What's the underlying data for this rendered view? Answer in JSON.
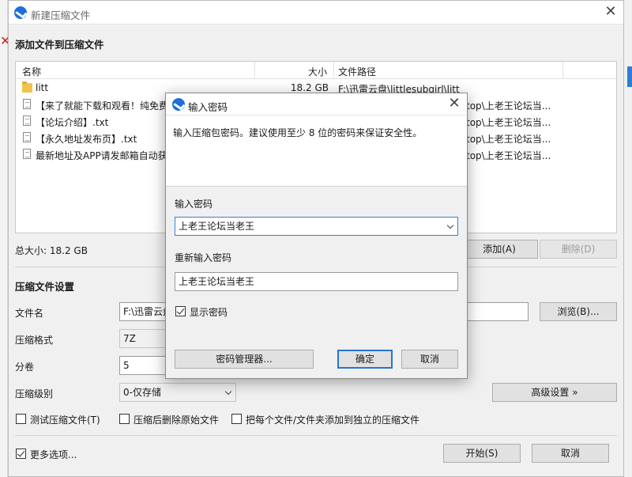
{
  "main_window": {
    "title": "新建压缩文件",
    "add_section_title": "添加文件到压缩文件",
    "columns": {
      "name": "名称",
      "size": "大小",
      "path": "文件路径"
    },
    "files": [
      {
        "icon": "folder-icon",
        "name": "litt",
        "size": "18.2 GB",
        "path": "F:\\迅雷云盘\\littlesubgirl\\litt"
      },
      {
        "icon": "file-icon",
        "name": "【来了就能下载和观看！纯免费",
        "size": "",
        "path": "top\\上老王论坛当..."
      },
      {
        "icon": "file-icon",
        "name": "【论坛介绍】.txt",
        "size": "",
        "path": "top\\上老王论坛当..."
      },
      {
        "icon": "file-icon",
        "name": "【永久地址发布页】.txt",
        "size": "",
        "path": "top\\上老王论坛当..."
      },
      {
        "icon": "file-icon",
        "name": "最新地址及APP请发邮箱自动获",
        "size": "",
        "path": "top\\上老王论坛当..."
      }
    ],
    "total_size": "总大小: 18.2 GB",
    "add_button": "添加(A)",
    "delete_button": "删除(D)",
    "settings_title": "压缩文件设置",
    "filename_label": "文件名",
    "filename_value": "F:\\迅雷云盘",
    "browse_button": "浏览(B)...",
    "format_label": "压缩格式",
    "format_value": "7Z",
    "volume_label": "分卷",
    "volume_value": "5",
    "level_label": "压缩级别",
    "level_value": "0-仅存储",
    "advanced_button": "高级设置 »",
    "opt_test": "测试压缩文件(T)",
    "opt_delete_source": "压缩后删除原始文件",
    "opt_separate": "把每个文件/文件夹添加到独立的压缩文件",
    "more_options": "更多选项...",
    "start_button": "开始(S)",
    "cancel_button": "取消"
  },
  "password_dialog": {
    "title": "输入密码",
    "description": "输入压缩包密码。建议使用至少 8 位的密码来保证安全性。",
    "password_label": "输入密码",
    "password_value": "上老王论坛当老王",
    "confirm_label": "重新输入密码",
    "confirm_value": "上老王论坛当老王",
    "show_password": "显示密码",
    "show_password_checked": true,
    "manager_button": "密码管理器...",
    "ok_button": "确定",
    "cancel_button": "取消"
  },
  "background_app": {
    "left_glyph": "✕"
  },
  "colors": {
    "accent": "#1e6fd9",
    "window_bg": "#f0f0f0"
  }
}
